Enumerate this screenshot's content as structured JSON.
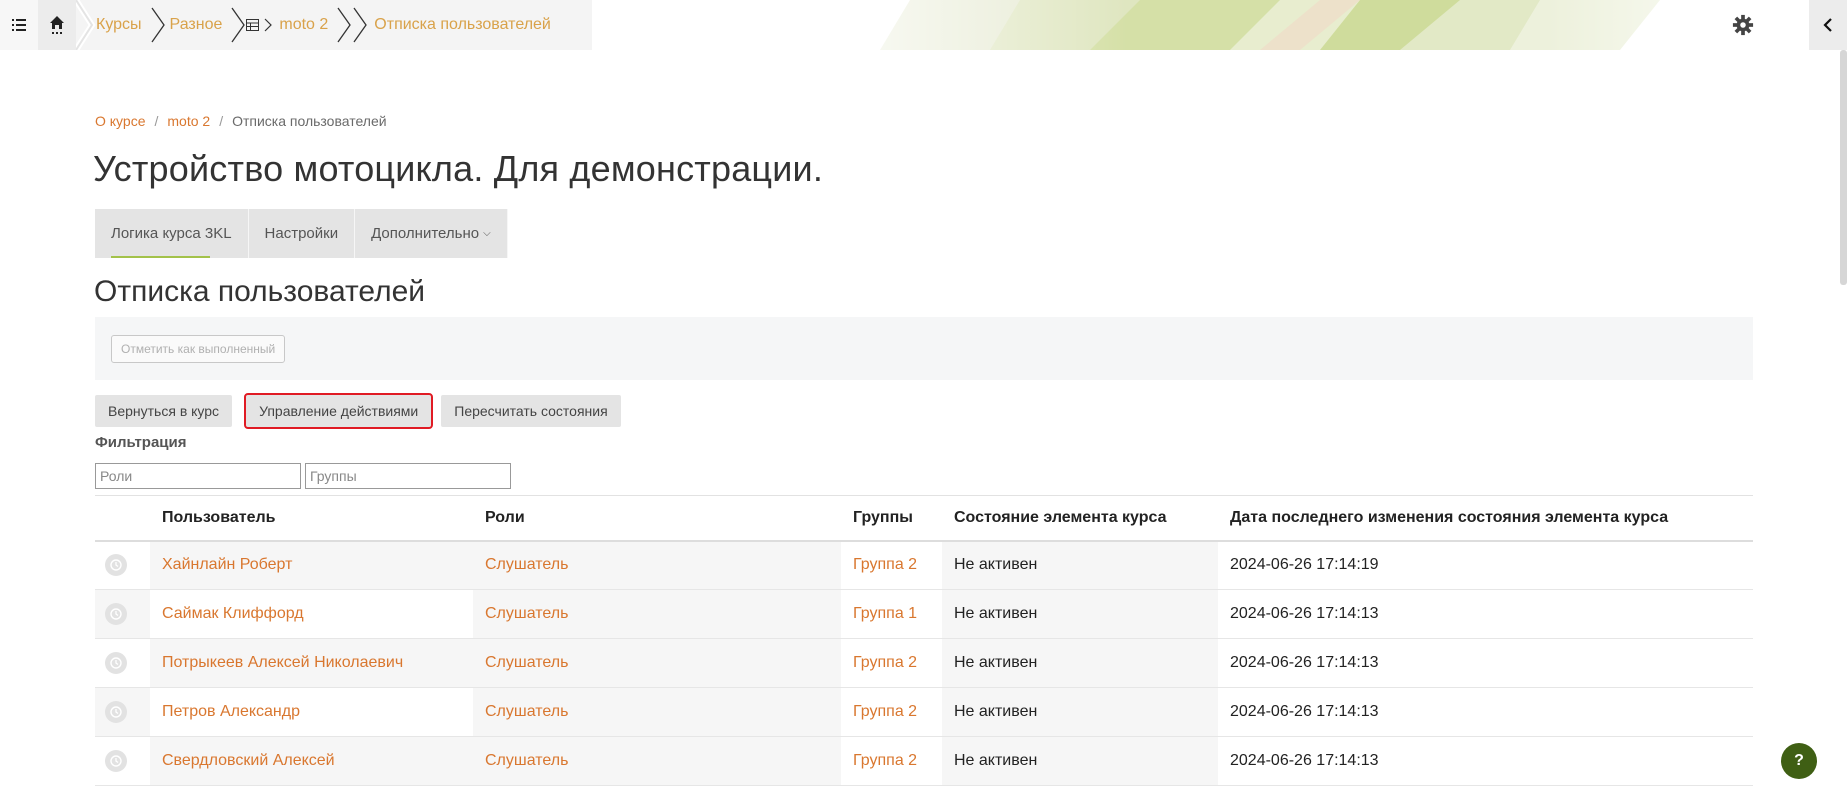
{
  "topbar": {
    "crumbs": [
      "Курсы",
      "Разное",
      "moto 2",
      "Отписка пользователей"
    ],
    "menu_icon": "list-icon",
    "home_icon": "home-icon",
    "settings_icon": "gear-icon",
    "drawer_icon": "chevron-left-icon"
  },
  "page_crumbs": [
    "О курсе",
    "moto 2",
    "Отписка пользователей"
  ],
  "course_title": "Устройство мотоцикла. Для демонстрации.",
  "secondary_nav": {
    "tabs": [
      "Логика курса 3KL",
      "Настройки",
      "Дополнительно"
    ]
  },
  "section_title": "Отписка пользователей",
  "mark_done_label": "Отметить как выполненный",
  "actions": [
    "Вернуться в курс",
    "Управление действиями",
    "Пересчитать состояния"
  ],
  "filter": {
    "label": "Фильтрация",
    "roles_placeholder": "Роли",
    "groups_placeholder": "Группы"
  },
  "table": {
    "headers": [
      "Пользователь",
      "Роли",
      "Группы",
      "Состояние элемента курса",
      "Дата последнего изменения состояния элемента курса"
    ],
    "rows": [
      {
        "user": "Хайнлайн Роберт",
        "role": "Слушатель",
        "group": "Группа 2",
        "state": "Не активен",
        "date": "2024-06-26 17:14:19"
      },
      {
        "user": "Саймак Клиффорд",
        "role": "Слушатель",
        "group": "Группа 1",
        "state": "Не активен",
        "date": "2024-06-26 17:14:13"
      },
      {
        "user": "Потрыкеев Алексей Николаевич",
        "role": "Слушатель",
        "group": "Группа 2",
        "state": "Не активен",
        "date": "2024-06-26 17:14:13"
      },
      {
        "user": "Петров Александр",
        "role": "Слушатель",
        "group": "Группа 2",
        "state": "Не активен",
        "date": "2024-06-26 17:14:13"
      },
      {
        "user": "Свердловский Алексей",
        "role": "Слушатель",
        "group": "Группа 2",
        "state": "Не активен",
        "date": "2024-06-26 17:14:13"
      }
    ]
  },
  "help_label": "?",
  "colors": {
    "link": "#d9772f",
    "crumb_link": "#d9a24a",
    "accent": "#a3c24a",
    "help_bg": "#3f5f14",
    "highlight": "#e01b24"
  }
}
